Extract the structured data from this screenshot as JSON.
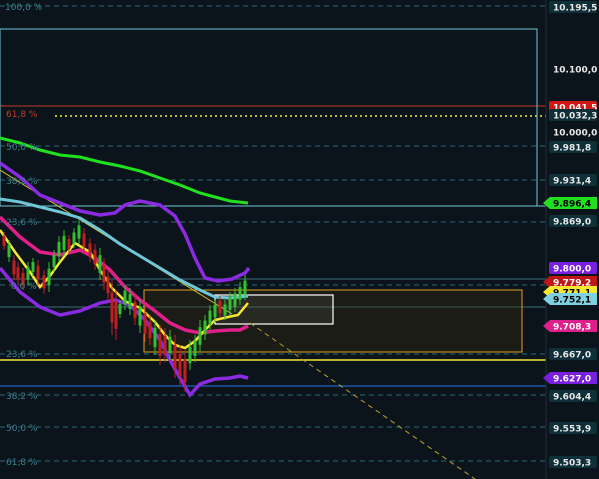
{
  "fib_labels": [
    {
      "text": "100,0 %",
      "color": "#3f7f8f"
    },
    {
      "text": "61,8 %",
      "color": "#c0392b"
    },
    {
      "text": "50,0 %",
      "color": "#3f7f8f"
    },
    {
      "text": "38,2 %",
      "color": "#3f7f8f"
    },
    {
      "text": "23,6 %",
      "color": "#3f7f8f"
    },
    {
      "text": "0,0 %",
      "color": "#3f7f8f"
    },
    {
      "text": "23,6 %",
      "color": "#3f7f8f"
    },
    {
      "text": "38,2 %",
      "color": "#3f7f8f"
    },
    {
      "text": "50,0 %",
      "color": "#3f7f8f"
    },
    {
      "text": "61,8 %",
      "color": "#3f7f8f"
    }
  ],
  "price_axis": [
    {
      "text": "10.195,5",
      "bg": "#0f3038",
      "fg": "#e8e8e8"
    },
    {
      "text": "10.100,0",
      "bg": "#0b141a",
      "fg": "#e8e8e8"
    },
    {
      "text": "10.041,5",
      "bg": "#d31818",
      "fg": "#ffffff"
    },
    {
      "text": "10.032,3",
      "bg": "#0f3038",
      "fg": "#e8e8e8"
    },
    {
      "text": "10.000,0",
      "bg": "#0b141a",
      "fg": "#e8e8e8"
    },
    {
      "text": "9.981,8",
      "bg": "#0f3038",
      "fg": "#e8e8e8"
    },
    {
      "text": "9.931,4",
      "bg": "#0f3038",
      "fg": "#e8e8e8"
    },
    {
      "text": "9.896,4",
      "bg": "#20e020",
      "fg": "#000000"
    },
    {
      "text": "9.869,0",
      "bg": "#0f3038",
      "fg": "#e8e8e8"
    },
    {
      "text": "9.800,0",
      "bg": "#7a1fe0",
      "fg": "#ffffff"
    },
    {
      "text": "9.779,2",
      "bg": "#c01818",
      "fg": "#ffffff"
    },
    {
      "text": "9.771,1",
      "bg": "#f5e830",
      "fg": "#000000"
    },
    {
      "text": "9.752,1",
      "bg": "#7fd0e0",
      "fg": "#000000"
    },
    {
      "text": "9.708,3",
      "bg": "#e0208a",
      "fg": "#ffffff"
    },
    {
      "text": "9.667,0",
      "bg": "#0f3038",
      "fg": "#e8e8e8"
    },
    {
      "text": "9.627,0",
      "bg": "#7a1fe0",
      "fg": "#ffffff"
    },
    {
      "text": "9.604,4",
      "bg": "#0f3038",
      "fg": "#e8e8e8"
    },
    {
      "text": "9.553,9",
      "bg": "#0f3038",
      "fg": "#e8e8e8"
    },
    {
      "text": "9.503,3",
      "bg": "#0f3038",
      "fg": "#e8e8e8"
    }
  ],
  "colors": {
    "background": "#0b141a",
    "fib_line": "#2a6a78",
    "resistance_line": "#c0392b",
    "support_line": "#2060c0",
    "dotted_level": "#b8b838",
    "ma_green": "#20e020",
    "ma_cyan": "#6fc6d6",
    "ma_magenta": "#e0208a",
    "ma_yellow": "#f5e830",
    "bollinger": "#8a2be2",
    "box_outline": "#e0a020"
  }
}
